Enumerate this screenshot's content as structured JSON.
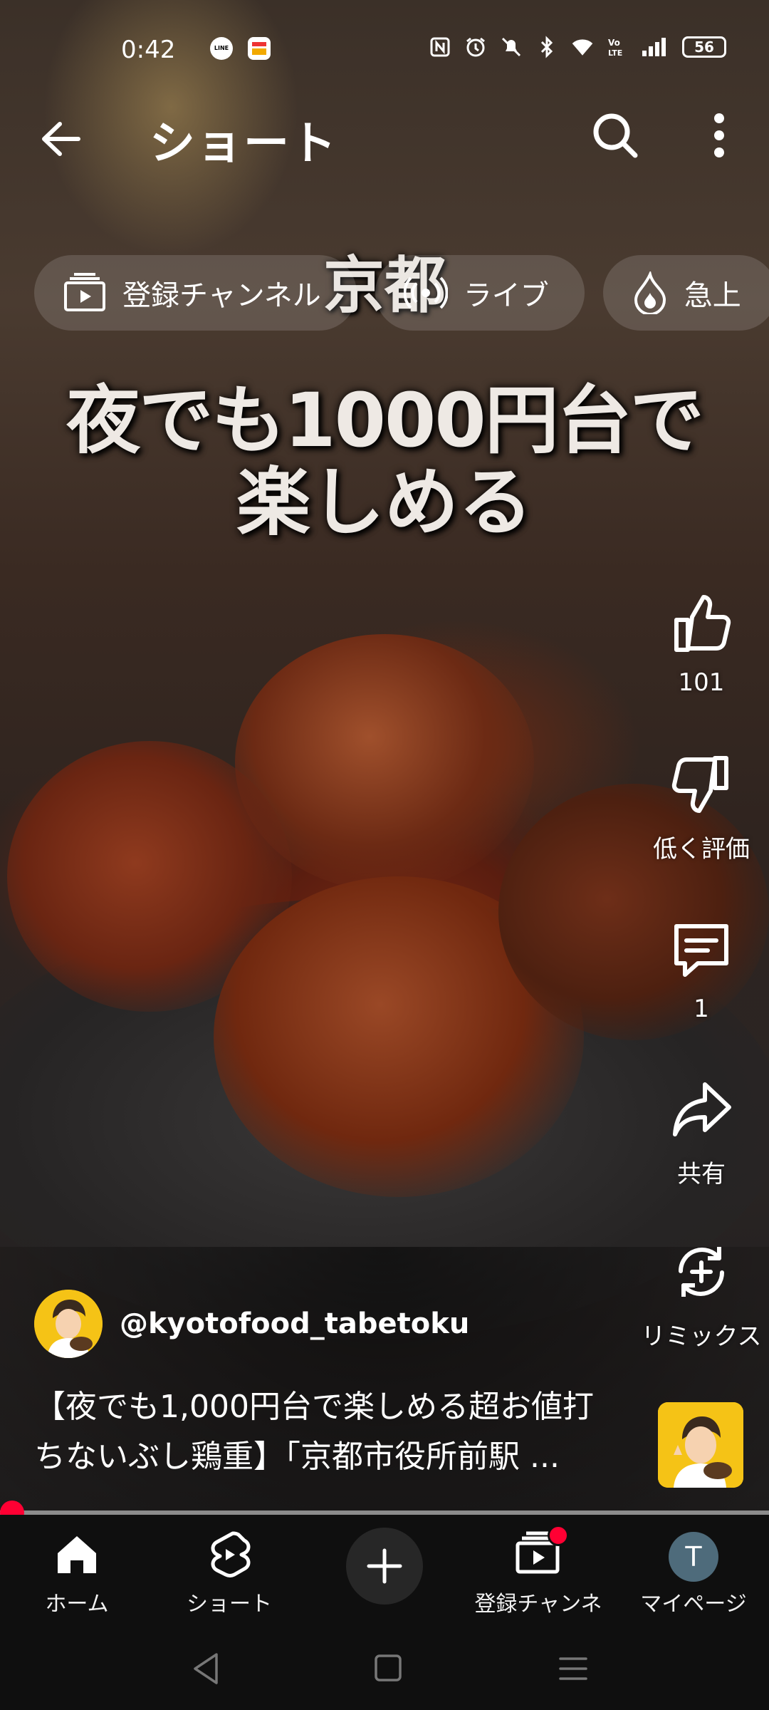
{
  "status_bar": {
    "time": "0:42",
    "notification_icons": [
      "line-icon",
      "app-badge-icon"
    ],
    "system_icons": [
      "nfc-icon",
      "alarm-icon",
      "mute-icon",
      "bluetooth-icon",
      "wifi-icon",
      "volte-icon",
      "signal-icon"
    ],
    "battery": "56"
  },
  "header": {
    "title": "ショート"
  },
  "chips": [
    {
      "label": "登録チャンネル",
      "icon": "subscriptions-icon"
    },
    {
      "label": "ライブ",
      "icon": "live-icon"
    },
    {
      "label": "急上",
      "icon": "trending-icon"
    }
  ],
  "video_captions": {
    "city": "京都",
    "line1": "夜でも1000円台で",
    "line2": "楽しめる"
  },
  "actions": {
    "like_count": "101",
    "dislike_label": "低く評価",
    "comment_count": "1",
    "share_label": "共有",
    "remix_label": "リミックス"
  },
  "channel": {
    "handle": "@kyotofood_tabetoku"
  },
  "description": {
    "line1": "【夜でも1,000円台で楽しめる超お値打",
    "line2": "ちないぶし鶏重】「京都市役所前駅 ..."
  },
  "playback": {
    "progress_fraction": 0.0
  },
  "bottom_nav": {
    "home": "ホーム",
    "shorts": "ショート",
    "subscriptions": "登録チャンネル",
    "my_page": "マイページ",
    "avatar_letter": "T"
  },
  "colors": {
    "accent_red": "#ff0033",
    "avatar_yellow": "#f5c316",
    "nav_background": "#0f0f0f"
  }
}
